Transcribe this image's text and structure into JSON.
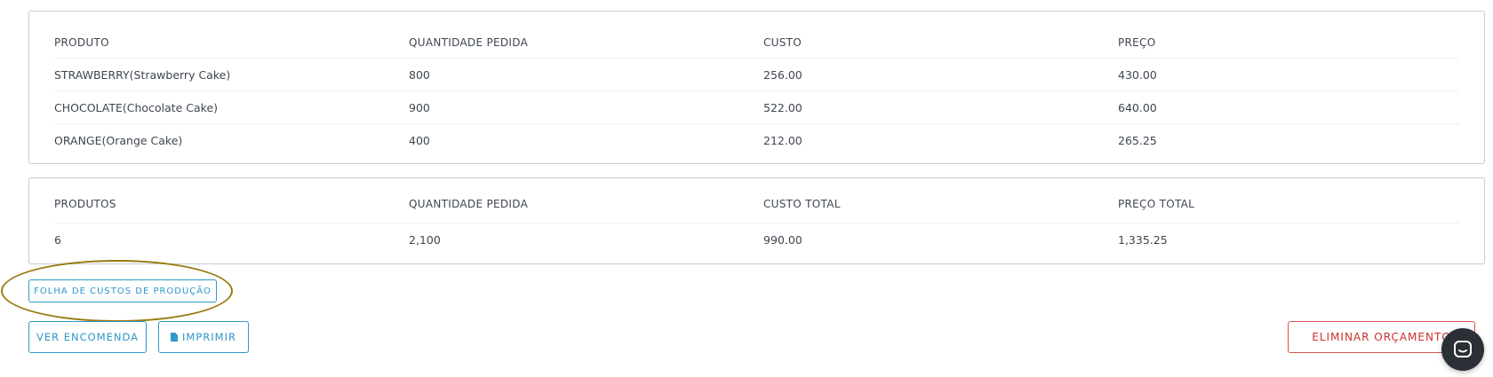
{
  "items_table": {
    "headers": [
      "PRODUTO",
      "QUANTIDADE PEDIDA",
      "CUSTO",
      "PREÇO"
    ],
    "rows": [
      [
        "STRAWBERRY(Strawberry Cake)",
        "800",
        "256.00",
        "430.00"
      ],
      [
        "CHOCOLATE(Chocolate Cake)",
        "900",
        "522.00",
        "640.00"
      ],
      [
        "ORANGE(Orange Cake)",
        "400",
        "212.00",
        "265.25"
      ]
    ]
  },
  "totals_table": {
    "headers": [
      "PRODUTOS",
      "QUANTIDADE PEDIDA",
      "CUSTO TOTAL",
      "PREÇO TOTAL"
    ],
    "row": [
      "6",
      "2,100",
      "990.00",
      "1,335.25"
    ]
  },
  "buttons": {
    "production_cost_sheet": "FOLHA DE CUSTOS DE PRODUÇÃO",
    "view_order": "VER ENCOMENDA",
    "print": "IMPRIMIR",
    "delete_quote": "ELIMINAR ORÇAMENTO"
  },
  "icons": {
    "print": "document-icon",
    "chat": "chat-bubble-icon"
  },
  "colors": {
    "primary": "#2f97c9",
    "danger": "#d9534f",
    "highlight": "#9a7a10",
    "chat_bg": "#2b2f36"
  }
}
